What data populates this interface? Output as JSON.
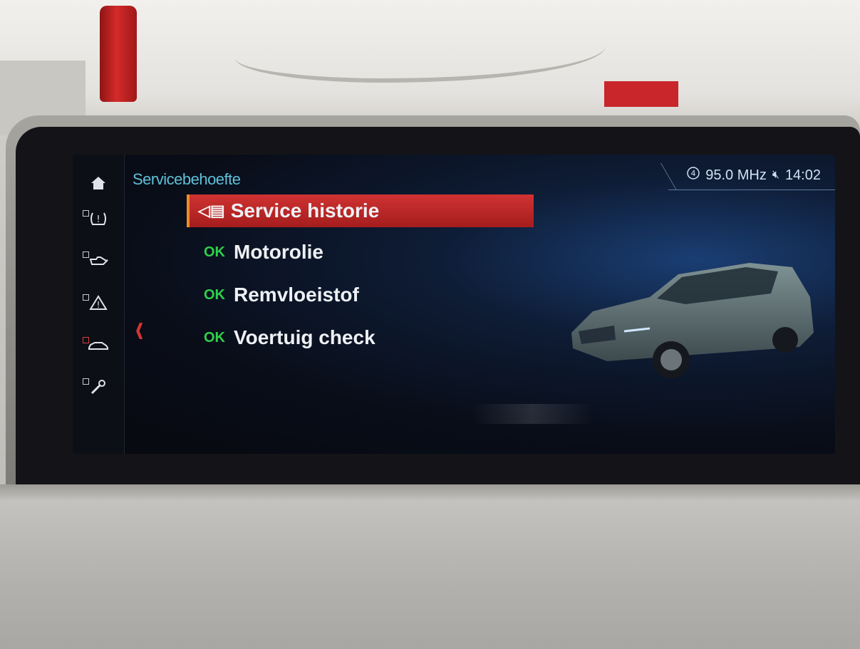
{
  "header": {
    "title": "Servicebehoefte"
  },
  "status": {
    "station_icon": "radio-preset-icon",
    "frequency": "95.0 MHz",
    "mute_icon": "speaker-muted-icon",
    "time": "14:02"
  },
  "sidebar": {
    "items": [
      {
        "icon": "home-icon"
      },
      {
        "icon": "tire-pressure-icon"
      },
      {
        "icon": "oil-can-icon"
      },
      {
        "icon": "warning-triangle-icon"
      },
      {
        "icon": "car-check-icon"
      },
      {
        "icon": "service-wrench-icon"
      }
    ]
  },
  "menu": {
    "items": [
      {
        "label": "Service historie",
        "status": "",
        "selected": true,
        "icon": "service-history-icon"
      },
      {
        "label": "Motorolie",
        "status": "OK",
        "selected": false
      },
      {
        "label": "Remvloeistof",
        "status": "OK",
        "selected": false
      },
      {
        "label": "Voertuig check",
        "status": "OK",
        "selected": false
      }
    ]
  },
  "colors": {
    "accent_title": "#5fc0d8",
    "selection": "#c02828",
    "ok": "#2fd04a",
    "back_arrow": "#d63434"
  }
}
